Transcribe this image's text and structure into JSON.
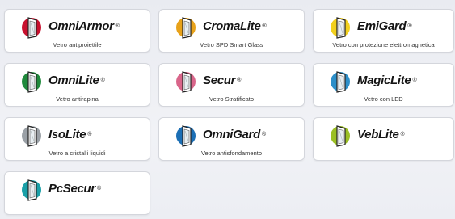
{
  "cards": [
    {
      "brand": "OmniArmor",
      "reg": "®",
      "caption": "Vetro antiproiettile",
      "color": "#c8102e",
      "icon": "shield-door-icon"
    },
    {
      "brand": "CromaLite",
      "reg": "®",
      "caption": "Vetro SPD Smart Glass",
      "color": "#e8a21a",
      "icon": "tinted-glass-icon"
    },
    {
      "brand": "EmiGard",
      "reg": "®",
      "caption": "Vetro con protezione elettromagnetica",
      "color": "#f2d01e",
      "icon": "emi-shield-icon"
    },
    {
      "brand": "OmniLite",
      "reg": "®",
      "caption": "Vetro antirapina",
      "color": "#1f8a3c",
      "icon": "anti-theft-icon"
    },
    {
      "brand": "Secur",
      "reg": "®",
      "caption": "Vetro Stratificato",
      "color": "#d9658a",
      "icon": "laminated-glass-icon"
    },
    {
      "brand": "MagicLite",
      "reg": "®",
      "caption": "Vetro con LED",
      "color": "#2d8fc9",
      "icon": "led-glass-icon"
    },
    {
      "brand": "IsoLite",
      "reg": "®",
      "caption": "Vetro a cristalli liquidi",
      "color": "#9aa0a6",
      "icon": "liquid-crystal-icon"
    },
    {
      "brand": "OmniGard",
      "reg": "®",
      "caption": "Vetro antisfondamento",
      "color": "#1c6fb5",
      "icon": "shatterproof-icon"
    },
    {
      "brand": "VebLite",
      "reg": "®",
      "caption": "",
      "color": "#9bbf24",
      "icon": "vebelite-glass-icon"
    },
    {
      "brand": "PcSecur",
      "reg": "®",
      "caption": "",
      "color": "#1aa0a8",
      "icon": "pc-glass-icon"
    }
  ]
}
